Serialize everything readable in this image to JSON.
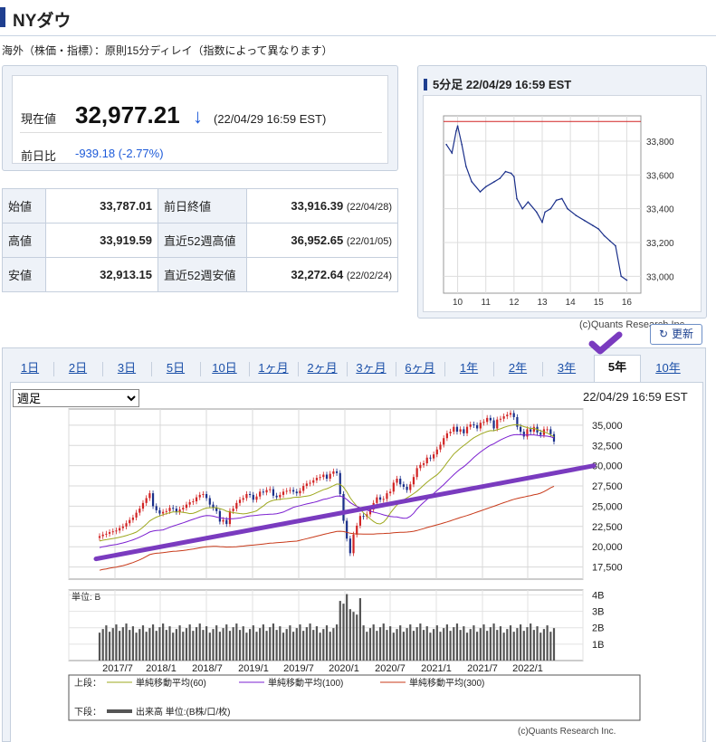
{
  "page": {
    "title": "NYダウ",
    "note": "海外（株価・指標）：原則15分ディレイ（指数によって異なります）"
  },
  "price": {
    "label": "現在値",
    "value": "32,977.21",
    "arrow": "↓",
    "time": "(22/04/29 16:59 EST)",
    "change_label": "前日比",
    "change": "-939.18 (-2.77%)"
  },
  "stats": {
    "rows": [
      {
        "k1": "始値",
        "v1": "33,787.01",
        "k2": "前日終値",
        "v2": "33,916.39",
        "d2": "(22/04/28)"
      },
      {
        "k1": "高値",
        "v1": "33,919.59",
        "k2": "直近52週高値",
        "v2": "36,952.65",
        "d2": "(22/01/05)"
      },
      {
        "k1": "安値",
        "v1": "32,913.15",
        "k2": "直近52週安値",
        "v2": "32,272.64",
        "d2": "(22/02/24)"
      }
    ]
  },
  "intraday": {
    "header": "5分足 22/04/29 16:59 EST",
    "credit": "(c)Quants Research Inc."
  },
  "refresh_label": "更新",
  "tabs": [
    "1日",
    "2日",
    "3日",
    "5日",
    "10日",
    "1ヶ月",
    "2ヶ月",
    "3ヶ月",
    "6ヶ月",
    "1年",
    "2年",
    "3年",
    "5年",
    "10年"
  ],
  "active_tab": "5年",
  "period_select": {
    "selected": "週足",
    "options": [
      "週足"
    ]
  },
  "chart_time": "22/04/29 16:59 EST",
  "colors": {
    "up_candle": "#d22424",
    "down_candle": "#1a2f8a",
    "ma60": "#9ea81e",
    "ma100": "#7b1fd0",
    "ma300": "#c83a1a",
    "trendline": "#7a3bbf",
    "volume": "#555555",
    "link": "#1a4fa8"
  },
  "chart_data": [
    {
      "type": "line",
      "title": "5分足 22/04/29 16:59 EST",
      "x_ticks": [
        "10",
        "11",
        "12",
        "13",
        "14",
        "15",
        "16"
      ],
      "y_ticks": [
        "33,800",
        "33,600",
        "33,400",
        "33,200",
        "33,000"
      ],
      "ylim": [
        32900,
        33950
      ],
      "reference_line": 33916.39,
      "x": [
        9.6,
        9.8,
        9.95,
        10.0,
        10.15,
        10.3,
        10.5,
        10.8,
        11.0,
        11.3,
        11.5,
        11.7,
        11.9,
        12.0,
        12.1,
        12.3,
        12.5,
        12.8,
        13.0,
        13.1,
        13.3,
        13.5,
        13.7,
        13.9,
        14.2,
        14.5,
        14.8,
        15.0,
        15.2,
        15.4,
        15.6,
        15.8,
        16.0
      ],
      "y": [
        33780,
        33730,
        33860,
        33890,
        33780,
        33650,
        33560,
        33500,
        33530,
        33560,
        33580,
        33620,
        33610,
        33590,
        33460,
        33400,
        33440,
        33380,
        33320,
        33380,
        33400,
        33450,
        33460,
        33400,
        33360,
        33330,
        33300,
        33280,
        33240,
        33210,
        33180,
        33000,
        32977
      ]
    },
    {
      "type": "bar",
      "title": "",
      "y_ticks": [
        "35,000",
        "32,500",
        "30,000",
        "27,500",
        "25,000",
        "22,500",
        "20,000",
        "17,500"
      ],
      "x_ticks": [
        "2017/7",
        "2018/1",
        "2018/7",
        "2019/1",
        "2019/7",
        "2020/1",
        "2020/7",
        "2021/1",
        "2021/7",
        "2022/1"
      ],
      "ylim": [
        16000,
        37000
      ],
      "series_close": [
        21300,
        21500,
        21600,
        21800,
        21900,
        22000,
        22300,
        22500,
        22900,
        23300,
        23600,
        24200,
        24700,
        25400,
        26000,
        26600,
        25000,
        24500,
        24100,
        24300,
        24400,
        24800,
        24700,
        24300,
        24600,
        24800,
        25200,
        25500,
        25600,
        26100,
        26400,
        26500,
        26000,
        25200,
        24800,
        24400,
        23100,
        23300,
        22800,
        24400,
        24700,
        25400,
        25800,
        26000,
        26500,
        26400,
        25800,
        26200,
        26800,
        26700,
        27000,
        27100,
        26300,
        26100,
        26400,
        26800,
        26900,
        27000,
        26800,
        26600,
        26900,
        27500,
        27800,
        27900,
        28200,
        28500,
        28600,
        28900,
        28400,
        29000,
        29300,
        29100,
        26500,
        23200,
        21000,
        19200,
        21500,
        22600,
        23800,
        23700,
        24000,
        24600,
        25400,
        26100,
        25800,
        25900,
        26600,
        26800,
        27900,
        28400,
        27700,
        27400,
        27000,
        27700,
        28600,
        29700,
        30100,
        30300,
        31000,
        30900,
        31400,
        32000,
        32600,
        33400,
        34000,
        34200,
        34800,
        34200,
        34500,
        34000,
        34800,
        35100,
        35000,
        34600,
        35300,
        35400,
        35900,
        35600,
        34600,
        35700,
        35800,
        36100,
        36300,
        36500,
        36000,
        34800,
        34200,
        33600,
        34500,
        34200,
        34800,
        34100,
        33800,
        34500,
        34500,
        33900,
        32977
      ],
      "ma_labels": [
        "単純移動平均(60)",
        "単純移動平均(100)",
        "単純移動平均(300)"
      ],
      "legend_top_label": "上段：",
      "legend_bottom_label": "下段：",
      "legend_volume": "出来高 単位:(B株/口/枚)",
      "volume_unit_label": "単位: B",
      "volume_ticks": [
        "4B",
        "3B",
        "2B",
        "1B"
      ],
      "credit": "(c)Quants Research Inc."
    }
  ]
}
